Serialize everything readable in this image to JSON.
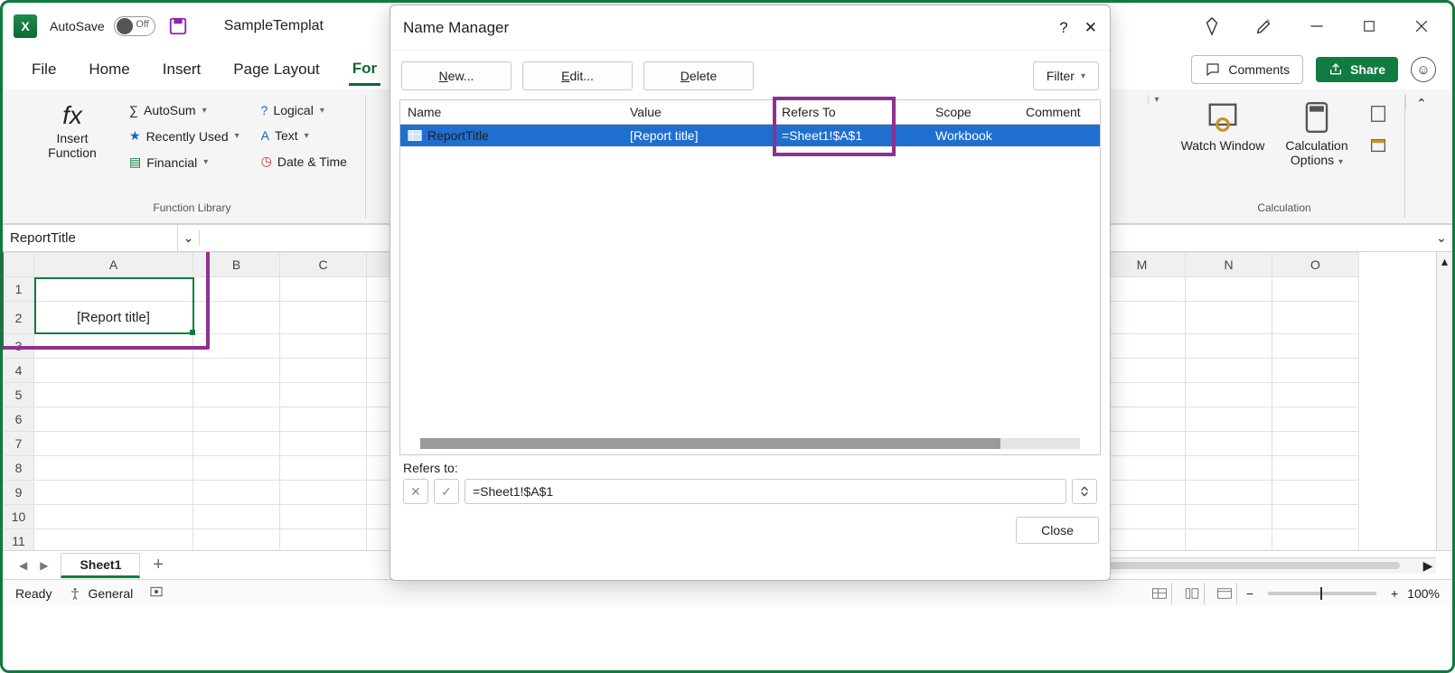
{
  "titlebar": {
    "autosave_label": "AutoSave",
    "autosave_off": "Off",
    "doc_title": "SampleTemplat"
  },
  "tabs": {
    "file": "File",
    "home": "Home",
    "insert": "Insert",
    "pagelayout": "Page Layout",
    "formulas": "For"
  },
  "top_right": {
    "comments": "Comments",
    "share": "Share"
  },
  "ribbon": {
    "insert_fn": "Insert Function",
    "autosum": "AutoSum",
    "recent": "Recently Used",
    "financial": "Financial",
    "logical": "Logical",
    "text": "Text",
    "datetime": "Date & Time",
    "lib_group": "Function Library",
    "watch": "Watch Window",
    "calc_opts": "Calculation Options",
    "calc_group": "Calculation"
  },
  "name_box": "ReportTitle",
  "sheet": {
    "cols": [
      "A",
      "B",
      "C",
      "M",
      "N",
      "O"
    ],
    "rows": [
      "1",
      "2",
      "3",
      "4",
      "5",
      "6",
      "7",
      "8",
      "9",
      "10",
      "11"
    ],
    "a1_value": "[Report title]",
    "tab": "Sheet1"
  },
  "status": {
    "ready": "Ready",
    "accessibility": "General",
    "zoom": "100%"
  },
  "dialog": {
    "title": "Name Manager",
    "new": "New...",
    "edit": "Edit...",
    "delete": "Delete",
    "filter": "Filter",
    "hdr_name": "Name",
    "hdr_value": "Value",
    "hdr_refersto": "Refers To",
    "hdr_scope": "Scope",
    "hdr_comment": "Comment",
    "row": {
      "name": "ReportTitle",
      "value": "[Report title]",
      "refersto": "=Sheet1!$A$1",
      "scope": "Workbook"
    },
    "refers_label": "Refers to:",
    "refers_value": "=Sheet1!$A$1",
    "close": "Close"
  }
}
